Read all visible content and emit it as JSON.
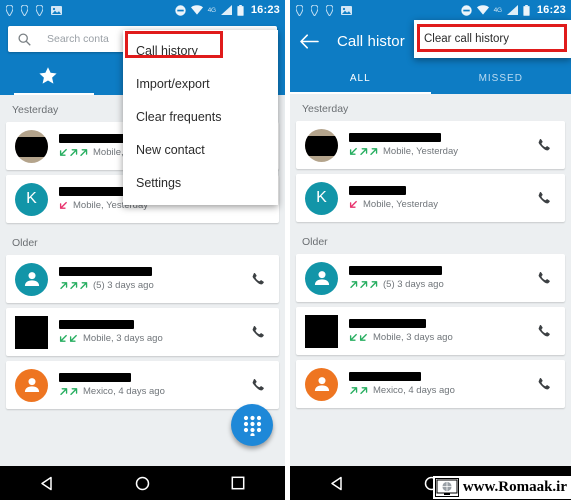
{
  "status_bar": {
    "time": "16:23",
    "network_label": "4G",
    "icons": [
      "location-icon",
      "location-icon",
      "location-icon",
      "photo-icon",
      "do-not-disturb-icon",
      "wifi-icon",
      "signal-icon",
      "battery-icon"
    ]
  },
  "colors": {
    "toolbar_blue": "#0d7cc4",
    "accent_red": "#e01b1b",
    "fab_blue": "#1e88d8",
    "avatar_teal": "#1295a8",
    "avatar_orange": "#ee7521",
    "incoming_green": "#27ae60",
    "missed_pink": "#e8336d",
    "list_background": "#eceff1"
  },
  "left_panel": {
    "search": {
      "placeholder": "Search conta",
      "icon": "search-icon"
    },
    "tabs": [
      {
        "name": "favorites",
        "icon": "star-icon",
        "active": true
      }
    ],
    "overflow_menu": {
      "items": [
        {
          "label": "Call history",
          "highlighted": true
        },
        {
          "label": "Import/export",
          "highlighted": false
        },
        {
          "label": "Clear frequents",
          "highlighted": false
        },
        {
          "label": "New contact",
          "highlighted": false
        },
        {
          "label": "Settings",
          "highlighted": false
        }
      ]
    },
    "sections": [
      {
        "label": "Yesterday",
        "entries": [
          {
            "avatar": {
              "type": "photo-redacted",
              "color": "#000000",
              "letter": ""
            },
            "name_redacted_width": 105,
            "arrows": [
              "incoming",
              "outgoing",
              "outgoing"
            ],
            "meta": "Mobile,",
            "call_icon": "phone-icon"
          },
          {
            "avatar": {
              "type": "letter",
              "color": "#1295a8",
              "letter": "K"
            },
            "name_redacted_width": 78,
            "arrows": [
              "missed"
            ],
            "meta": "Mobile, Yesterday",
            "call_icon": "phone-icon"
          }
        ]
      },
      {
        "label": "Older",
        "entries": [
          {
            "avatar": {
              "type": "person",
              "color": "#1295a8",
              "letter": ""
            },
            "name_redacted_width": 93,
            "arrows": [
              "outgoing",
              "outgoing",
              "outgoing"
            ],
            "meta": "(5) 3 days ago",
            "call_icon": "phone-icon"
          },
          {
            "avatar": {
              "type": "square-redacted",
              "color": "#000000",
              "letter": ""
            },
            "name_redacted_width": 75,
            "arrows": [
              "incoming",
              "incoming"
            ],
            "meta": "Mobile, 3 days ago",
            "call_icon": "phone-icon"
          },
          {
            "avatar": {
              "type": "person",
              "color": "#ee7521",
              "letter": ""
            },
            "name_redacted_width": 72,
            "arrows": [
              "outgoing",
              "outgoing"
            ],
            "meta": "Mexico, 4 days ago",
            "call_icon": "phone-icon"
          }
        ]
      }
    ],
    "fab": {
      "icon": "dialpad-icon"
    }
  },
  "right_panel": {
    "header": {
      "back_icon": "back-arrow-icon",
      "title": "Call histor"
    },
    "tabs": [
      {
        "label": "ALL",
        "active": true
      },
      {
        "label": "MISSED",
        "active": false
      }
    ],
    "overflow_menu": {
      "items": [
        {
          "label": "Clear call history",
          "highlighted": true
        }
      ]
    },
    "sections": [
      {
        "label": "Yesterday",
        "entries": [
          {
            "avatar": {
              "type": "photo-redacted",
              "color": "#000000",
              "letter": ""
            },
            "name_redacted_width": 92,
            "arrows": [
              "incoming",
              "outgoing",
              "outgoing"
            ],
            "meta": "Mobile, Yesterday",
            "call_icon": "phone-icon"
          },
          {
            "avatar": {
              "type": "letter",
              "color": "#1295a8",
              "letter": "K"
            },
            "name_redacted_width": 57,
            "arrows": [
              "missed"
            ],
            "meta": "Mobile, Yesterday",
            "call_icon": "phone-icon"
          }
        ]
      },
      {
        "label": "Older",
        "entries": [
          {
            "avatar": {
              "type": "person",
              "color": "#1295a8",
              "letter": ""
            },
            "name_redacted_width": 93,
            "arrows": [
              "outgoing",
              "outgoing",
              "outgoing"
            ],
            "meta": "(5) 3 days ago",
            "call_icon": "phone-icon"
          },
          {
            "avatar": {
              "type": "square-redacted",
              "color": "#000000",
              "letter": ""
            },
            "name_redacted_width": 77,
            "arrows": [
              "incoming",
              "incoming"
            ],
            "meta": "Mobile, 3 days ago",
            "call_icon": "phone-icon"
          },
          {
            "avatar": {
              "type": "person",
              "color": "#ee7521",
              "letter": ""
            },
            "name_redacted_width": 72,
            "arrows": [
              "outgoing",
              "outgoing"
            ],
            "meta": "Mexico, 4 days ago",
            "call_icon": "phone-icon"
          }
        ]
      }
    ]
  },
  "nav_bar": {
    "buttons": [
      {
        "name": "back",
        "icon": "triangle-back-icon"
      },
      {
        "name": "home",
        "icon": "circle-home-icon"
      },
      {
        "name": "recents",
        "icon": "square-recents-icon"
      }
    ]
  },
  "watermark": {
    "text": "www.Romaak.ir",
    "icon": "globe-monitor-icon"
  }
}
